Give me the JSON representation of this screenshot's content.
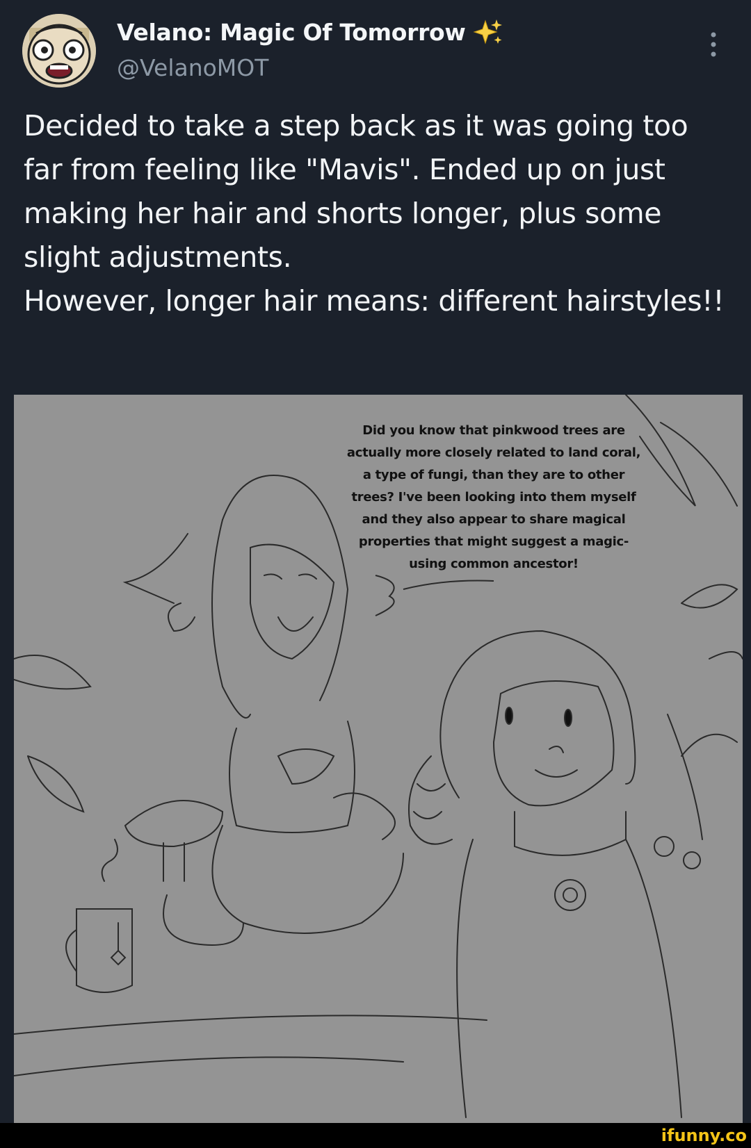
{
  "tweet": {
    "author": {
      "display_name": "Velano: Magic Of Tomorrow",
      "handle": "@VelanoMOT",
      "avatar_icon": "cartoon-face-avatar",
      "badge_icon": "sparkles-emoji"
    },
    "more_icon": "vertical-ellipsis-icon",
    "text": "Decided to take a step back as it was going too far from feeling like \"Mavis\". Ended up on just making her hair and shorts longer, plus some slight adjustments.\nHowever, longer hair means: different hairstyles!!"
  },
  "media": {
    "speech_bubble": "Did you know that pinkwood trees are actually more closely related to land coral, a type of fungi, than they are to other trees? I've been looking into them myself and they also appear to share magical properties that might suggest a magic-using common ancestor!"
  },
  "watermark": "ifunny.co",
  "colors": {
    "background": "#1b212b",
    "text": "#f2f4f6",
    "muted": "#8d99a6",
    "image_gray": "#949494",
    "watermark": "#f5c518"
  }
}
